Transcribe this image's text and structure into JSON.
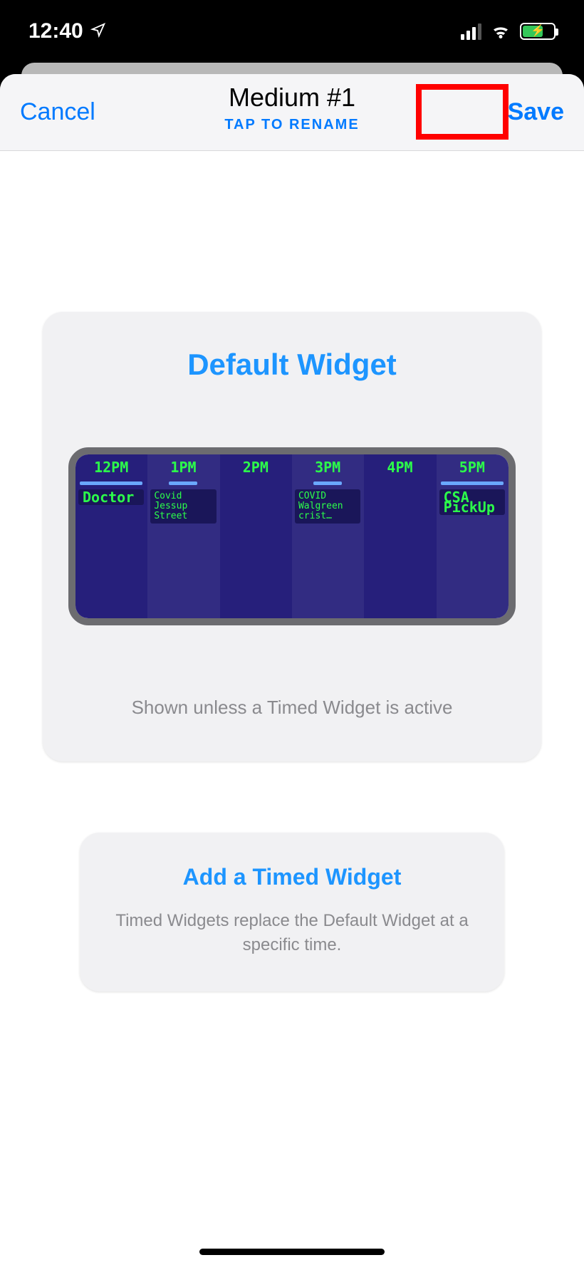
{
  "status_bar": {
    "time": "12:40"
  },
  "nav": {
    "cancel": "Cancel",
    "title": "Medium #1",
    "subtitle": "TAP TO RENAME",
    "save": "Save"
  },
  "default_widget": {
    "heading": "Default Widget",
    "caption": "Shown unless a Timed Widget is active",
    "calendar": {
      "columns": [
        {
          "time": "12PM",
          "bar": "full",
          "event": "Doctor",
          "size": "big"
        },
        {
          "time": "1PM",
          "bar": "short",
          "event": "Covid Jessup Street",
          "size": "small"
        },
        {
          "time": "2PM",
          "bar": "none",
          "event": "",
          "size": ""
        },
        {
          "time": "3PM",
          "bar": "short",
          "event": "COVID Walgreen crist…",
          "size": "small"
        },
        {
          "time": "4PM",
          "bar": "none",
          "event": "",
          "size": ""
        },
        {
          "time": "5PM",
          "bar": "full",
          "event": "CSA PickUp",
          "size": "big"
        }
      ]
    }
  },
  "add_timed": {
    "heading": "Add a Timed Widget",
    "caption": "Timed Widgets replace the Default Widget at a specific time."
  }
}
